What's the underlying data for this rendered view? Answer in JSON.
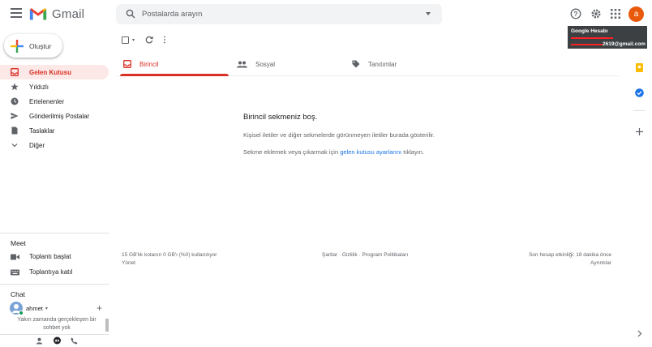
{
  "header": {
    "app_name": "Gmail",
    "search_placeholder": "Postalarda arayın",
    "avatar_letter": "a",
    "tooltip": {
      "title": "Google Hesabı",
      "email_suffix": "2619@gmail.com"
    }
  },
  "compose": {
    "label": "Oluştur"
  },
  "nav": {
    "items": [
      {
        "label": "Gelen Kutusu",
        "icon": "inbox-icon",
        "active": true
      },
      {
        "label": "Yıldızlı",
        "icon": "star-icon"
      },
      {
        "label": "Ertelenenler",
        "icon": "clock-icon"
      },
      {
        "label": "Gönderilmiş Postalar",
        "icon": "send-icon"
      },
      {
        "label": "Taslaklar",
        "icon": "draft-icon"
      },
      {
        "label": "Diğer",
        "icon": "chevron-down-icon"
      }
    ]
  },
  "meet": {
    "title": "Meet",
    "start": "Toplantı başlat",
    "join": "Toplantıya katıl"
  },
  "chat": {
    "title": "Chat",
    "user": "ahmet",
    "note_line1": "Yakın zamanda gerçekleşen bir",
    "note_line2": "sohbet yok"
  },
  "tabs": [
    {
      "label": "Birincil",
      "active": true
    },
    {
      "label": "Sosyal"
    },
    {
      "label": "Tanıtımlar"
    }
  ],
  "empty": {
    "title": "Birincil sekmeniz boş.",
    "line1": "Kişisel iletiler ve diğer sekmelerde görünmeyen iletiler burada gösterilir.",
    "line2_prefix": "Sekme eklemek veya çıkarmak için",
    "line2_link": "gelen kutusu ayarlarını",
    "line2_suffix": "tıklayın."
  },
  "footer": {
    "storage": "15 GB'lık kotanın 0 GB'ı (%0) kullanılıyor",
    "manage": "Yönet",
    "terms": "Şartlar · Gizlilik · Program Politikaları",
    "activity": "Son hesap etkinliği: 18 dakika önce",
    "details": "Ayrıntılar"
  },
  "colors": {
    "accent_red": "#d93025",
    "active_bg": "#fce8e6",
    "link_blue": "#1a73e8",
    "avatar_orange": "#e8590c"
  }
}
